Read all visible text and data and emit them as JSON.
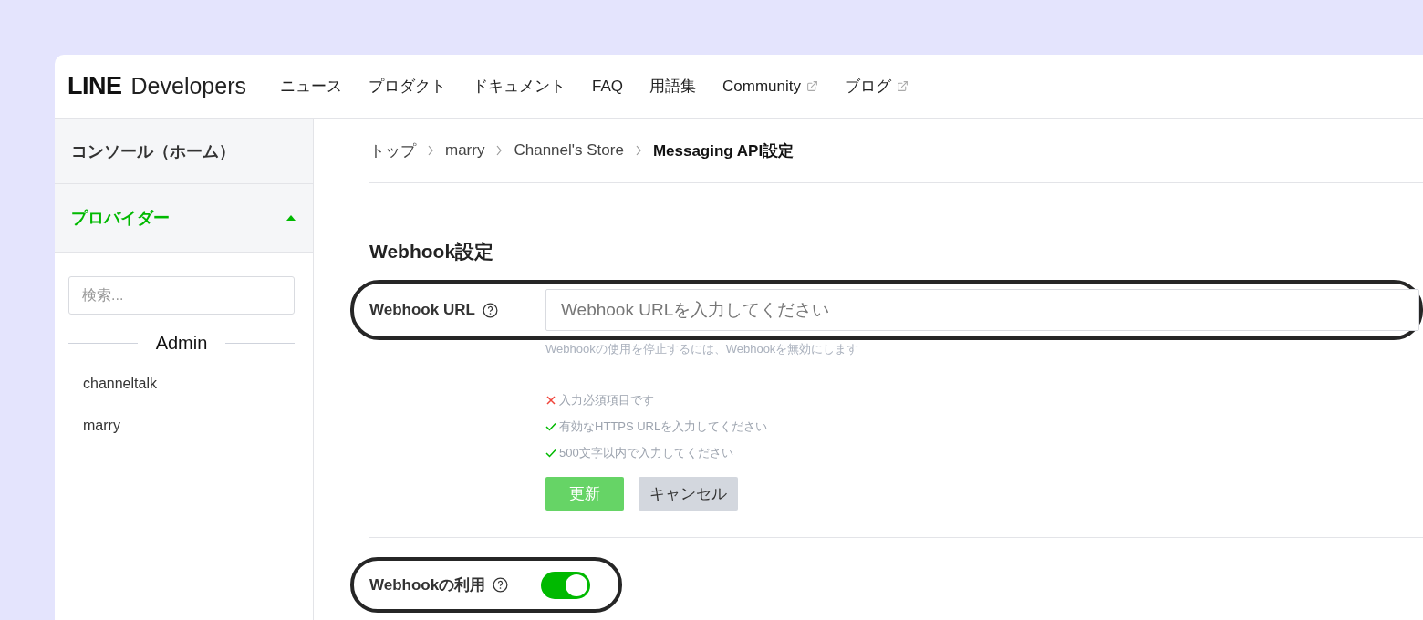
{
  "header": {
    "logo": {
      "brand": "LINE",
      "product": "Developers"
    },
    "nav": [
      {
        "label": "ニュース",
        "external": false
      },
      {
        "label": "プロダクト",
        "external": false
      },
      {
        "label": "ドキュメント",
        "external": false
      },
      {
        "label": "FAQ",
        "external": false
      },
      {
        "label": "用語集",
        "external": false
      },
      {
        "label": "Community",
        "external": true
      },
      {
        "label": "ブログ",
        "external": true
      }
    ]
  },
  "sidebar": {
    "home": "コンソール（ホーム）",
    "section": {
      "label": "プロバイダー",
      "expanded": true
    },
    "search": {
      "placeholder": "検索..."
    },
    "group": "Admin",
    "items": [
      {
        "label": "channeltalk"
      },
      {
        "label": "marry"
      }
    ]
  },
  "breadcrumb": [
    {
      "label": "トップ",
      "current": false
    },
    {
      "label": "marry",
      "current": false
    },
    {
      "label": "Channel's Store",
      "current": false
    },
    {
      "label": "Messaging API設定",
      "current": true
    }
  ],
  "webhook": {
    "title": "Webhook設定",
    "url": {
      "label": "Webhook URL",
      "placeholder": "Webhook URLを入力してください",
      "hint": "Webhookの使用を停止するには、Webhookを無効にします",
      "validations": [
        {
          "text": "入力必須項目です",
          "kind": "error"
        },
        {
          "text": "有効なHTTPS URLを入力してください",
          "kind": "ok"
        },
        {
          "text": "500文字以内で入力してください",
          "kind": "ok"
        }
      ],
      "buttons": [
        {
          "label": "更新",
          "kind": "primary"
        },
        {
          "label": "キャンセル",
          "kind": "secondary"
        }
      ]
    },
    "use": {
      "label": "Webhookの利用",
      "on": true
    }
  }
}
